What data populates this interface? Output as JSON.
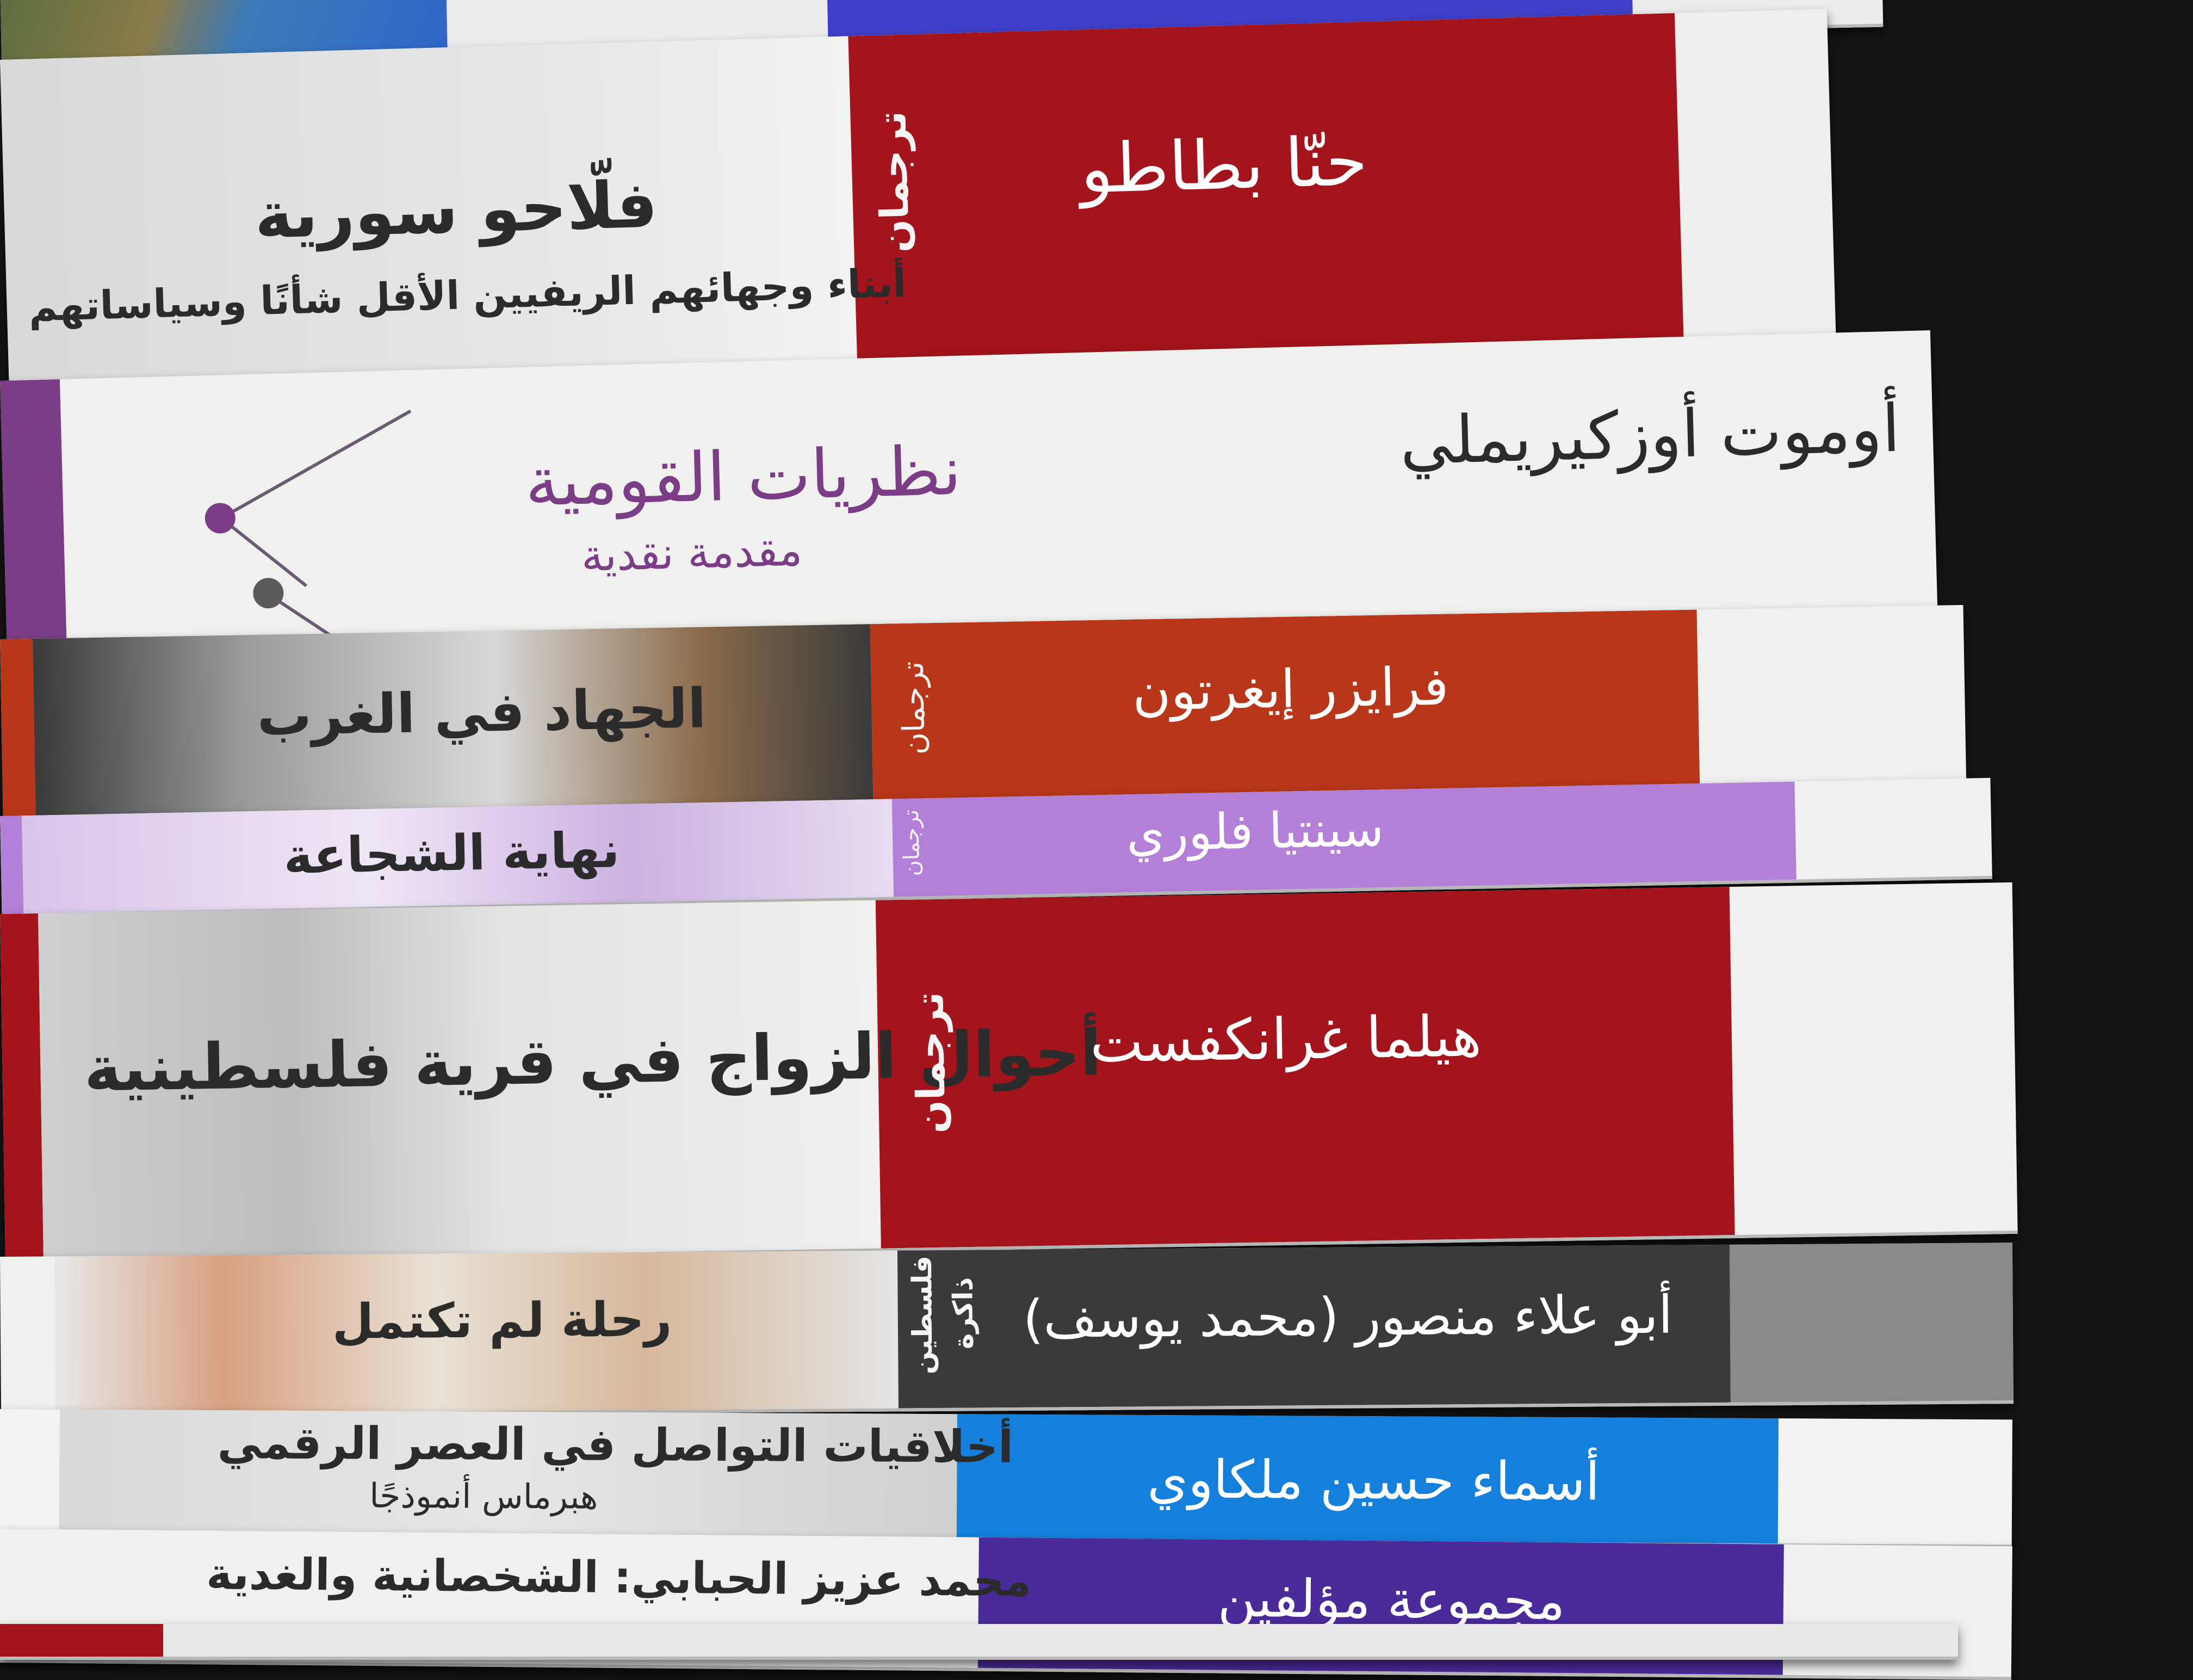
{
  "books": [
    {
      "id": "book-1",
      "title": "فلّاحو سورية",
      "subtitle": "أبناء وجهائهم الريفيين الأقل شأنًا وسياساتهم",
      "series": "ترجمان",
      "author": "حنّا بطاطو"
    },
    {
      "id": "book-2",
      "title": "نظريات القومية",
      "subtitle": "مقدمة نقدية",
      "author": "أوموت أوزكيريملي"
    },
    {
      "id": "book-3",
      "title": "الجهاد في الغرب",
      "series": "ترجمان",
      "author": "فرايزر إيغرتون"
    },
    {
      "id": "book-4",
      "title": "نهاية الشجاعة",
      "series": "ترجمان",
      "author": "سينتيا فلوري"
    },
    {
      "id": "book-5",
      "title": "أحوال الزواج في قرية فلسطينية",
      "series": "ترجمان",
      "author": "هيلما غرانكفست"
    },
    {
      "id": "book-6",
      "title": "رحلة لم تكتمل",
      "series_1": "ذاكرة",
      "series_2": "فلسطين",
      "author": "أبو علاء منصور (محمد يوسف)"
    },
    {
      "id": "book-7",
      "title": "أخلاقيات التواصل في العصر الرقمي",
      "subtitle": "هبرماس أنموذجًا",
      "author": "أسماء حسين ملكاوي"
    },
    {
      "id": "book-8",
      "title": "محمد عزيز الحبابي: الشخصانية والغدية",
      "author": "مجموعة مؤلفين"
    }
  ],
  "colors": {
    "dark_red": "#a3141c",
    "orange_red": "#b8361a",
    "lilac": "#b47fd6",
    "purple_text": "#7b3d86",
    "charcoal": "#3a3a3a",
    "blue": "#1480dc",
    "indigo": "#4b2a9a",
    "white_spine": "#efefee"
  }
}
